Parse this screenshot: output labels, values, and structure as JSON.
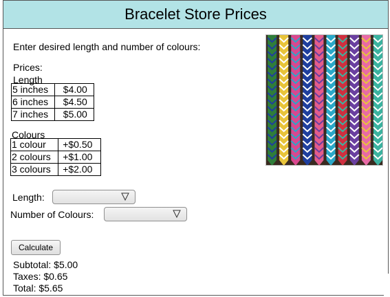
{
  "title": "Bracelet Store Prices",
  "instructions": "Enter desired length and number of colours:",
  "prices_heading": "Prices:",
  "length_table": {
    "caption": "Length",
    "rows": [
      {
        "label": "5 inches",
        "price": "$4.00"
      },
      {
        "label": "6 inches",
        "price": "$4.50"
      },
      {
        "label": "7 inches",
        "price": "$5.00"
      }
    ]
  },
  "colours_table": {
    "caption": "Colours",
    "rows": [
      {
        "label": "1 colour",
        "price": "+$0.50"
      },
      {
        "label": "2 colours",
        "price": "+$1.00"
      },
      {
        "label": "3 colours",
        "price": "+$2.00"
      }
    ]
  },
  "form": {
    "length_label": "Length:",
    "length_value": "",
    "colours_label": "Number of Colours:",
    "colours_value": "",
    "calculate_label": "Calculate"
  },
  "results": {
    "subtotal": "Subtotal: $5.00",
    "taxes": "Taxes: $0.65",
    "total": "Total: $5.65"
  },
  "image": {
    "subject": "friendship bracelets photo",
    "background_color": "#3a2a20",
    "bracelet_colors": [
      "#2f7d3a",
      "#e8c43a",
      "#d9488f",
      "#1f3f9e",
      "#e45c8c",
      "#2aa8c8",
      "#cf2f3f",
      "#6a3fa0",
      "#e86aa5",
      "#3bb3a0"
    ]
  },
  "colors": {
    "titlebar_bg": "#b2e3e6",
    "border": "#555555"
  }
}
